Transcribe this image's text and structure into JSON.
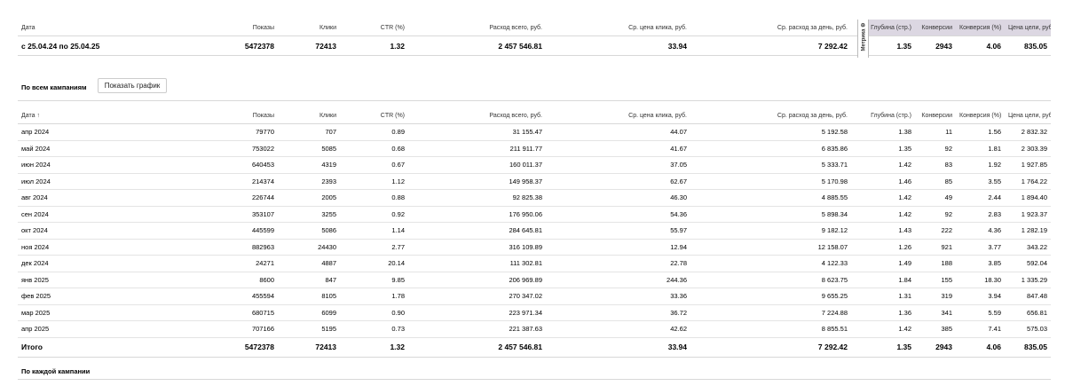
{
  "summary": {
    "headers": [
      "Дата",
      "Показы",
      "Клики",
      "CTR (%)",
      "Расход всего, руб.",
      "Ср. цена клика, руб.",
      "Ср. расход за день, руб.",
      "Глубина (стр.)",
      "Конверсии",
      "Конверсия (%)",
      "Цена цели, руб."
    ],
    "metrika_label": "Метрика",
    "metrika_icon": "gear-icon",
    "row": [
      "с 25.04.24 по 25.04.25",
      "5472378",
      "72413",
      "1.32",
      "2 457 546.81",
      "33.94",
      "7 292.42",
      "1.35",
      "2943",
      "4.06",
      "835.05"
    ]
  },
  "all_campaigns": {
    "title": "По всем кампаниям",
    "button_label": "Показать график",
    "headers": [
      "Дата",
      "Показы",
      "Клики",
      "CTR (%)",
      "Расход всего, руб.",
      "Ср. цена клика, руб.",
      "Ср. расход за день, руб.",
      "Глубина (стр.)",
      "Конверсии",
      "Конверсия (%)",
      "Цена цели, руб."
    ],
    "sort_indicator": "↑",
    "rows": [
      [
        "апр 2024",
        "79770",
        "707",
        "0.89",
        "31 155.47",
        "44.07",
        "5 192.58",
        "1.38",
        "11",
        "1.56",
        "2 832.32"
      ],
      [
        "май 2024",
        "753022",
        "5085",
        "0.68",
        "211 911.77",
        "41.67",
        "6 835.86",
        "1.35",
        "92",
        "1.81",
        "2 303.39"
      ],
      [
        "июн 2024",
        "640453",
        "4319",
        "0.67",
        "160 011.37",
        "37.05",
        "5 333.71",
        "1.42",
        "83",
        "1.92",
        "1 927.85"
      ],
      [
        "июл 2024",
        "214374",
        "2393",
        "1.12",
        "149 958.37",
        "62.67",
        "5 170.98",
        "1.46",
        "85",
        "3.55",
        "1 764.22"
      ],
      [
        "авг 2024",
        "226744",
        "2005",
        "0.88",
        "92 825.38",
        "46.30",
        "4 885.55",
        "1.42",
        "49",
        "2.44",
        "1 894.40"
      ],
      [
        "сен 2024",
        "353107",
        "3255",
        "0.92",
        "176 950.06",
        "54.36",
        "5 898.34",
        "1.42",
        "92",
        "2.83",
        "1 923.37"
      ],
      [
        "окт 2024",
        "445599",
        "5086",
        "1.14",
        "284 645.81",
        "55.97",
        "9 182.12",
        "1.43",
        "222",
        "4.36",
        "1 282.19"
      ],
      [
        "ноя 2024",
        "882963",
        "24430",
        "2.77",
        "316 109.89",
        "12.94",
        "12 158.07",
        "1.26",
        "921",
        "3.77",
        "343.22"
      ],
      [
        "дек 2024",
        "24271",
        "4887",
        "20.14",
        "111 302.81",
        "22.78",
        "4 122.33",
        "1.49",
        "188",
        "3.85",
        "592.04"
      ],
      [
        "янв 2025",
        "8600",
        "847",
        "9.85",
        "206 969.89",
        "244.36",
        "8 623.75",
        "1.84",
        "155",
        "18.30",
        "1 335.29"
      ],
      [
        "фев 2025",
        "455594",
        "8105",
        "1.78",
        "270 347.02",
        "33.36",
        "9 655.25",
        "1.31",
        "319",
        "3.94",
        "847.48"
      ],
      [
        "мар 2025",
        "680715",
        "6099",
        "0.90",
        "223 971.34",
        "36.72",
        "7 224.88",
        "1.36",
        "341",
        "5.59",
        "656.81"
      ],
      [
        "апр 2025",
        "707166",
        "5195",
        "0.73",
        "221 387.63",
        "42.62",
        "8 855.51",
        "1.42",
        "385",
        "7.41",
        "575.03"
      ]
    ],
    "total": [
      "Итого",
      "5472378",
      "72413",
      "1.32",
      "2 457 546.81",
      "33.94",
      "7 292.42",
      "1.35",
      "2943",
      "4.06",
      "835.05"
    ]
  },
  "each_campaign": {
    "title": "По каждой кампании"
  }
}
